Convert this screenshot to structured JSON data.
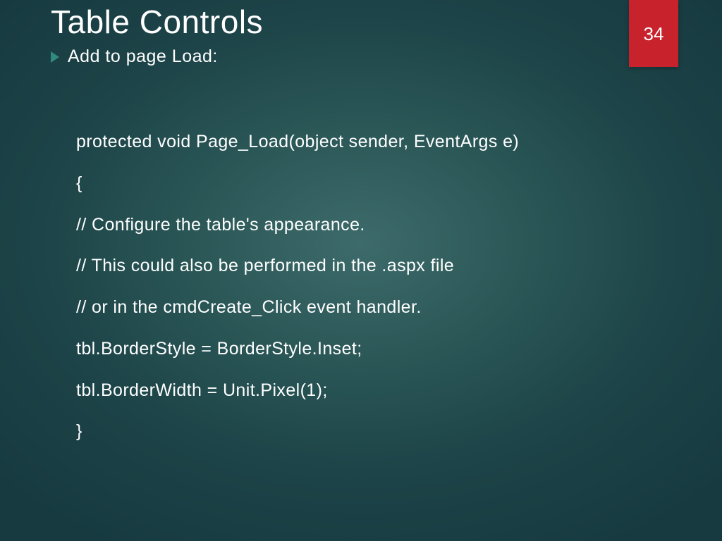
{
  "slide": {
    "title": "Table Controls",
    "page_number": "34",
    "bullet": "Add to page Load:",
    "code_lines": [
      "protected void Page_Load(object sender, EventArgs e)",
      "{",
      "// Configure the table's appearance.",
      "// This could also be performed in the .aspx file",
      "// or in the cmdCreate_Click event handler.",
      "tbl.BorderStyle = BorderStyle.Inset;",
      "tbl.BorderWidth = Unit.Pixel(1);",
      "}"
    ]
  }
}
